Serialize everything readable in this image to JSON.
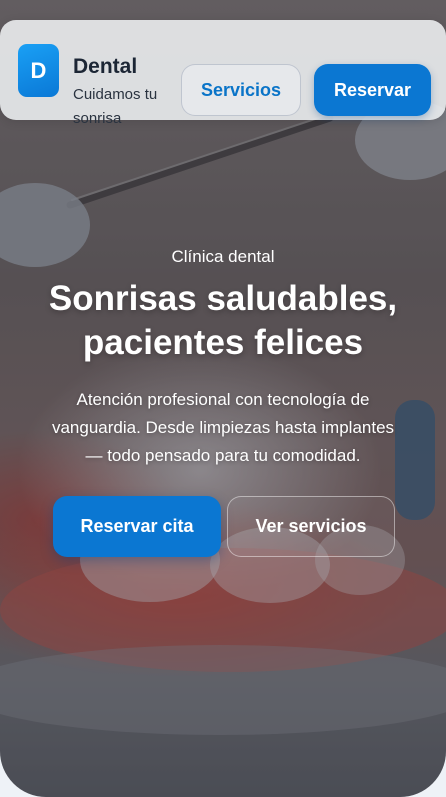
{
  "header": {
    "logo_letter": "D",
    "brand_name": "Dental",
    "tagline": "Cuidamos tu sonrisa",
    "services_label": "Servicios",
    "book_label": "Reservar"
  },
  "hero": {
    "eyebrow": "Clínica dental",
    "headline": "Sonrisas saludables, pacientes felices",
    "description": "Atención profesional con tecnología de vanguardia. Desde limpiezas hasta implantes — todo pensado para tu comodidad.",
    "primary_cta": "Reservar cita",
    "secondary_cta": "Ver servicios",
    "background_image": "dental-model-photo"
  },
  "colors": {
    "accent": "#0b77d2",
    "text_dark": "#1c2635",
    "text_on_image": "#ffffff"
  }
}
